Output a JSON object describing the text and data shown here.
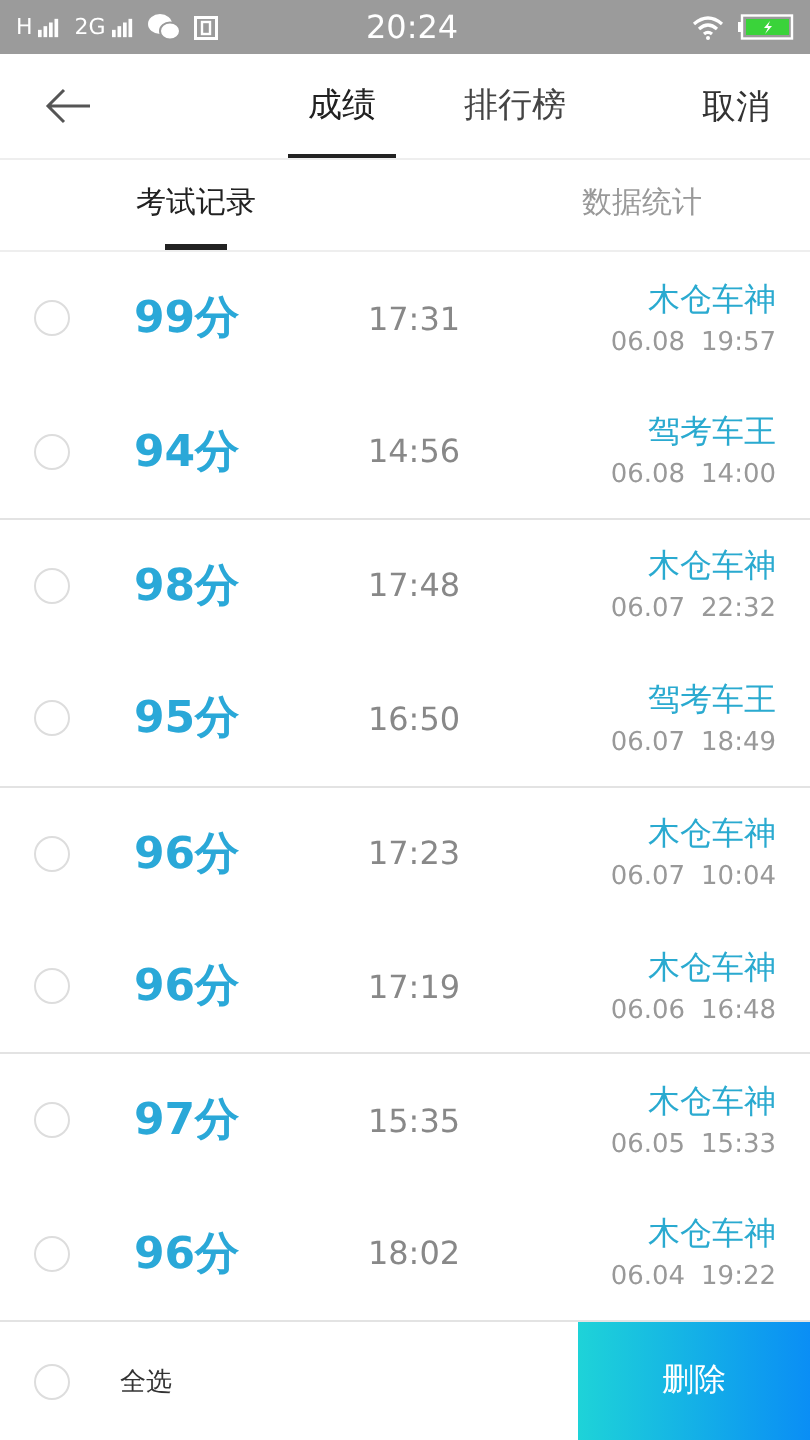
{
  "status_bar": {
    "network_1": "H",
    "network_2": "2G",
    "time": "20:24"
  },
  "header": {
    "tabs": [
      {
        "label": "成绩",
        "selected": true
      },
      {
        "label": "排行榜",
        "selected": false
      }
    ],
    "cancel": "取消"
  },
  "sub_tabs": [
    {
      "label": "考试记录",
      "selected": true
    },
    {
      "label": "数据统计",
      "selected": false
    }
  ],
  "records": [
    {
      "checked": false,
      "score": "99分",
      "duration": "17:31",
      "name": "木仓车神",
      "date": "06.08",
      "time": "19:57"
    },
    {
      "checked": false,
      "score": "94分",
      "duration": "14:56",
      "name": "驾考车王",
      "date": "06.08",
      "time": "14:00"
    },
    {
      "checked": false,
      "score": "98分",
      "duration": "17:48",
      "name": "木仓车神",
      "date": "06.07",
      "time": "22:32"
    },
    {
      "checked": false,
      "score": "95分",
      "duration": "16:50",
      "name": "驾考车王",
      "date": "06.07",
      "time": "18:49"
    },
    {
      "checked": false,
      "score": "96分",
      "duration": "17:23",
      "name": "木仓车神",
      "date": "06.07",
      "time": "10:04"
    },
    {
      "checked": false,
      "score": "96分",
      "duration": "17:19",
      "name": "木仓车神",
      "date": "06.06",
      "time": "16:48"
    },
    {
      "checked": false,
      "score": "97分",
      "duration": "15:35",
      "name": "木仓车神",
      "date": "06.05",
      "time": "15:33"
    },
    {
      "checked": false,
      "score": "96分",
      "duration": "18:02",
      "name": "木仓车神",
      "date": "06.04",
      "time": "19:22"
    }
  ],
  "footer": {
    "select_all": {
      "label": "全选",
      "checked": false
    },
    "delete": "删除"
  }
}
